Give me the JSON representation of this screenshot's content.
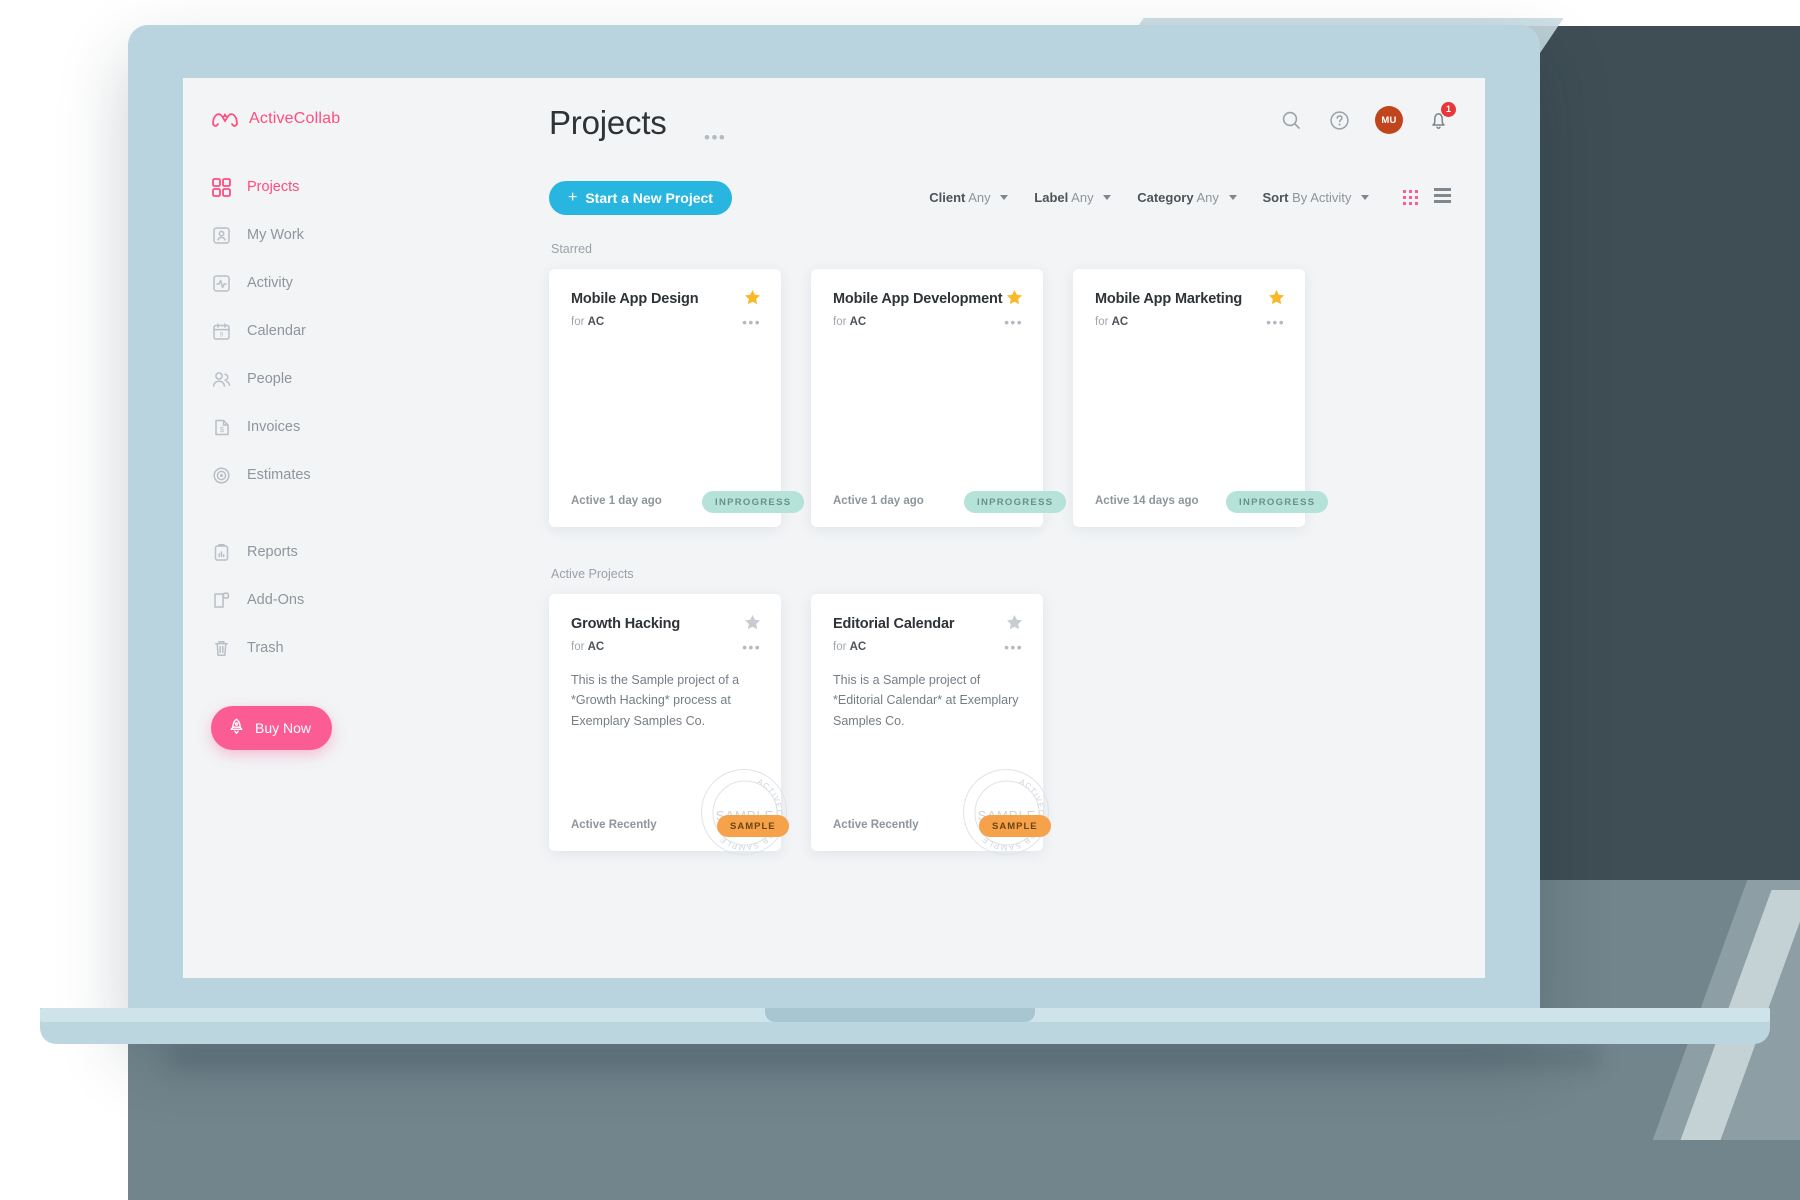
{
  "brand": {
    "name": "ActiveCollab",
    "logo_icon": "activecollab-logo-icon",
    "color": "#ff4d7e"
  },
  "sidebar": {
    "items": [
      {
        "label": "Projects",
        "icon": "grid-icon",
        "active": true
      },
      {
        "label": "My Work",
        "icon": "user-card-icon",
        "active": false
      },
      {
        "label": "Activity",
        "icon": "pulse-icon",
        "active": false
      },
      {
        "label": "Calendar",
        "icon": "calendar-icon",
        "active": false
      },
      {
        "label": "People",
        "icon": "people-icon",
        "active": false
      },
      {
        "label": "Invoices",
        "icon": "dollar-doc-icon",
        "active": false
      },
      {
        "label": "Estimates",
        "icon": "target-icon",
        "active": false
      },
      {
        "label": "Reports",
        "icon": "clipboard-chart-icon",
        "active": false
      },
      {
        "label": "Add-Ons",
        "icon": "addons-icon",
        "active": false
      },
      {
        "label": "Trash",
        "icon": "trash-icon",
        "active": false
      }
    ],
    "group_break_after": 6,
    "buy_now": {
      "label": "Buy Now",
      "icon": "rocket-icon",
      "color": "#fc5c94"
    }
  },
  "header": {
    "title": "Projects",
    "title_menu": "•••",
    "search_icon": "search-icon",
    "help_icon": "question-circle-icon",
    "avatar_initials": "MU",
    "avatar_color": "#c1451c",
    "bell_icon": "bell-icon",
    "notification_count": "1",
    "notification_color": "#e8373c"
  },
  "toolbar": {
    "new_project_label": "Start a New Project",
    "new_project_plus": "+",
    "new_project_color": "#28b6e0",
    "filters": [
      {
        "name": "Client",
        "value": "Any"
      },
      {
        "name": "Label",
        "value": "Any"
      },
      {
        "name": "Category",
        "value": "Any"
      }
    ],
    "sort": {
      "name": "Sort",
      "value": "By Activity"
    },
    "grid_view_icon": "grid-view-icon",
    "list_view_icon": "list-view-icon",
    "active_view": "grid"
  },
  "sections": [
    {
      "label": "Starred",
      "cards": [
        {
          "title": "Mobile App Design",
          "for_prefix": "for",
          "for_client": "AC",
          "description": "",
          "starred": true,
          "menu": "•••",
          "footer_time": "Active 1 day ago",
          "badge": "INPROGRESS",
          "badge_kind": "progress",
          "stamp": false
        },
        {
          "title": "Mobile App Development",
          "for_prefix": "for",
          "for_client": "AC",
          "description": "",
          "starred": true,
          "menu": "•••",
          "footer_time": "Active 1 day ago",
          "badge": "INPROGRESS",
          "badge_kind": "progress",
          "stamp": false
        },
        {
          "title": "Mobile App Marketing",
          "for_prefix": "for",
          "for_client": "AC",
          "description": "",
          "starred": true,
          "menu": "•••",
          "footer_time": "Active 14 days ago",
          "badge": "INPROGRESS",
          "badge_kind": "progress",
          "stamp": false
        }
      ]
    },
    {
      "label": "Active Projects",
      "cards": [
        {
          "title": "Growth Hacking",
          "for_prefix": "for",
          "for_client": "AC",
          "description": "This is the Sample project of a *Growth Hacking* process at Exemplary Samples Co.",
          "starred": false,
          "menu": "•••",
          "footer_time": "Active Recently",
          "badge": "SAMPLE",
          "badge_kind": "sample",
          "stamp": true,
          "stamp_text": "ACTIVECOLLAB SAMPLE"
        },
        {
          "title": "Editorial Calendar",
          "for_prefix": "for",
          "for_client": "AC",
          "description": "This is a Sample project of *Editorial Calendar* at Exemplary Samples Co.",
          "starred": false,
          "menu": "•••",
          "footer_time": "Active Recently",
          "badge": "SAMPLE",
          "badge_kind": "sample",
          "stamp": true,
          "stamp_text": "ACTIVECOLLAB SAMPLE"
        }
      ]
    }
  ],
  "colors": {
    "accent_pink": "#ff4d7e",
    "cyan": "#28b6e0",
    "badge_green": "#b6e3d9",
    "badge_orange": "#f6a24a",
    "star_gold": "#f9b829",
    "star_gray": "#c6ccd2"
  }
}
